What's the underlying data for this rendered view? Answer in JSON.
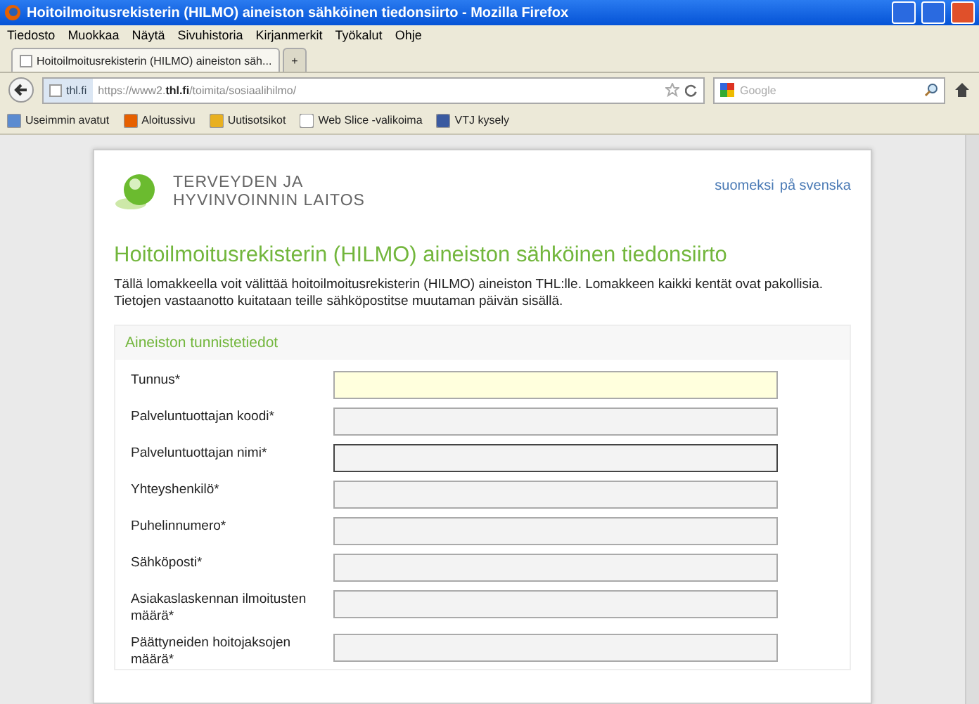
{
  "window": {
    "title": "Hoitoilmoitusrekisterin (HILMO) aineiston sähköinen tiedonsiirto - Mozilla Firefox"
  },
  "menu": [
    "Tiedosto",
    "Muokkaa",
    "Näytä",
    "Sivuhistoria",
    "Kirjanmerkit",
    "Työkalut",
    "Ohje"
  ],
  "tabs": [
    {
      "label": "Hoitoilmoitusrekisterin (HILMO) aineiston säh...",
      "selected": true
    },
    {
      "label": "+",
      "selected": false
    }
  ],
  "address": {
    "site": "thl.fi",
    "url_prefix": "https://www2.",
    "url_domain": "thl.fi",
    "url_path": "/toimita/sosiaalihilmo/"
  },
  "search": {
    "placeholder": "Google"
  },
  "bookmarks": [
    "Useimmin avatut",
    "Aloitussivu",
    "Uutisotsikot",
    "Web Slice -valikoima",
    "VTJ kysely"
  ],
  "page": {
    "logo_lines": [
      "TERVEYDEN JA",
      "HYVINVOINNIN LAITOS"
    ],
    "language_links": [
      "suomeksi",
      "på svenska"
    ],
    "heading": "Hoitoilmoitusrekisterin (HILMO) aineiston sähköinen tiedonsiirto",
    "intro": "Tällä lomakkeella voit välittää hoitoilmoitusrekisterin (HILMO) aineiston THL:lle. Lomakkeen kaikki kentät ovat pakollisia. Tietojen vastaanotto kuitataan teille sähköpostitse muutaman päivän sisällä.",
    "section": {
      "title": "Aineiston tunnistetiedot",
      "fields": [
        {
          "label": "Tunnus*",
          "kind": "highlighted"
        },
        {
          "label": "Palveluntuottajan koodi*",
          "kind": "normal"
        },
        {
          "label": "Palveluntuottajan nimi*",
          "kind": "focused"
        },
        {
          "label": "Yhteyshenkilö*",
          "kind": "normal"
        },
        {
          "label": "Puhelinnumero*",
          "kind": "normal"
        },
        {
          "label": "Sähköposti*",
          "kind": "normal"
        },
        {
          "label": "Asiakaslaskennan ilmoitusten määrä*",
          "kind": "normal"
        },
        {
          "label": "Päättyneiden hoitojaksojen määrä*",
          "kind": "normal"
        }
      ]
    }
  }
}
